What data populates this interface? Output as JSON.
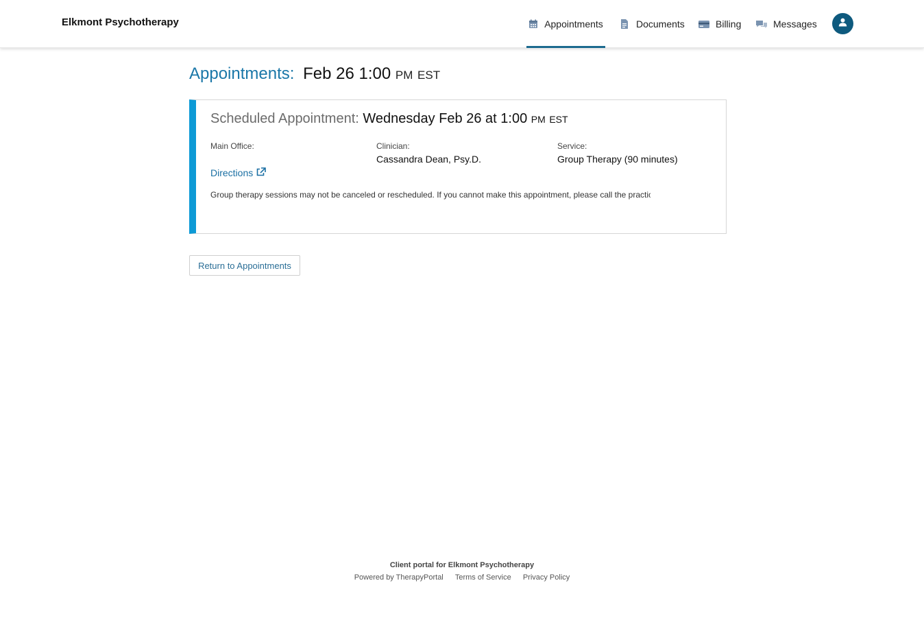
{
  "header": {
    "brand": "Elkmont Psychotherapy",
    "nav": [
      {
        "label": "Appointments",
        "icon": "calendar-icon",
        "active": true
      },
      {
        "label": "Documents",
        "icon": "document-icon",
        "active": false
      },
      {
        "label": "Billing",
        "icon": "credit-card-icon",
        "active": false
      },
      {
        "label": "Messages",
        "icon": "chat-icon",
        "active": false
      }
    ],
    "avatar_icon": "user-icon"
  },
  "page": {
    "title_label": "Appointments:",
    "title_date": "Feb 26 1:00",
    "title_ampm": "PM",
    "title_tz": "EST"
  },
  "appointment": {
    "heading_label": "Scheduled Appointment:",
    "heading_date": "Wednesday Feb 26 at 1:00",
    "heading_ampm": "PM",
    "heading_tz": "EST",
    "location_label": "Main Office:",
    "clinician_label": "Clinician:",
    "clinician_value": "Cassandra Dean, Psy.D.",
    "service_label": "Service:",
    "service_value": "Group Therapy (90 minutes)",
    "directions_label": "Directions",
    "notice": "Group therapy sessions may not be canceled or rescheduled. If you cannot make this appointment, please call the practice at (",
    "accent_color": "#0d9ad6"
  },
  "actions": {
    "return_label": "Return to Appointments"
  },
  "footer": {
    "line1": "Client portal for Elkmont Psychotherapy",
    "powered": "Powered by TherapyPortal",
    "terms": "Terms of Service",
    "privacy": "Privacy Policy"
  }
}
